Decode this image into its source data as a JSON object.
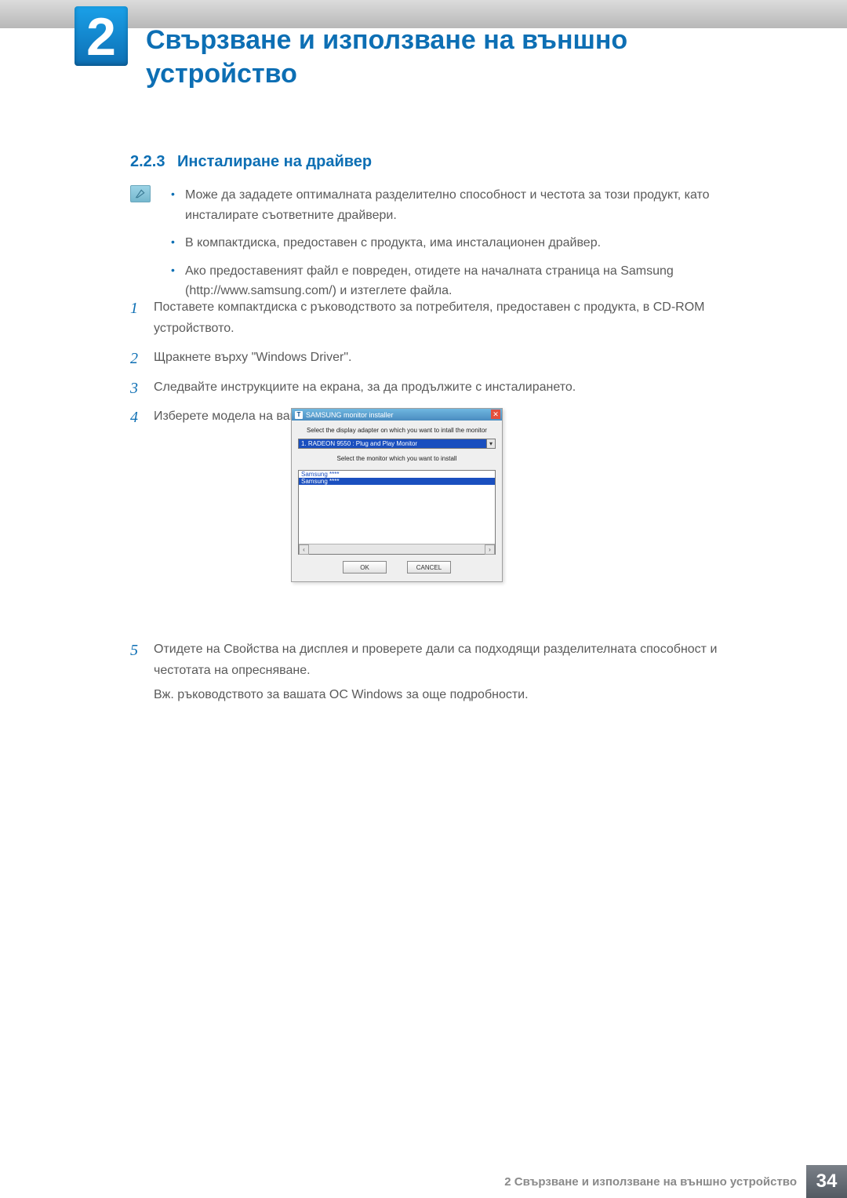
{
  "chapter": {
    "number": "2",
    "title": "Свързване и използване на външно устройство"
  },
  "section": {
    "number": "2.2.3",
    "title": "Инсталиране на драйвер"
  },
  "notes": [
    "Може да зададете оптималната разделително способност и честота за този продукт, като инсталирате съответните драйвери.",
    "В компактдиска, предоставен с продукта, има инсталационен драйвер.",
    "Ако предоставеният файл е повреден, отидете на началната страница на Samsung (http://www.samsung.com/) и изтеглете файла."
  ],
  "steps": {
    "s1": {
      "num": "1",
      "text": "Поставете компактдиска с ръководството за потребителя, предоставен с продукта, в CD-ROM устройството."
    },
    "s2": {
      "num": "2",
      "text": "Щракнете върху \"Windows Driver\"."
    },
    "s3": {
      "num": "3",
      "text": "Следвайте инструкциите на екрана, за да продължите с инсталирането."
    },
    "s4": {
      "num": "4",
      "text": "Изберете модела на вашия продукт от списъка с модели."
    },
    "s5": {
      "num": "5",
      "text": "Отидете на Свойства на дисплея и проверете дали са подходящи разделителната способност и честотата на опресняване.",
      "tail": "Вж. ръководството за вашата ОС Windows за още подробности."
    }
  },
  "installer": {
    "title": "SAMSUNG monitor installer",
    "msg_adapter": "Select the display adapter on which you want to intall the monitor",
    "adapter_value": "1. RADEON 9550 : Plug and Play Monitor",
    "msg_monitor": "Select the monitor which you want to install",
    "monitors": [
      "Samsung ****",
      "Samsung ****"
    ],
    "ok": "OK",
    "cancel": "CANCEL"
  },
  "footer": {
    "text": "2 Свързване и използване на външно устройство",
    "page": "34"
  }
}
